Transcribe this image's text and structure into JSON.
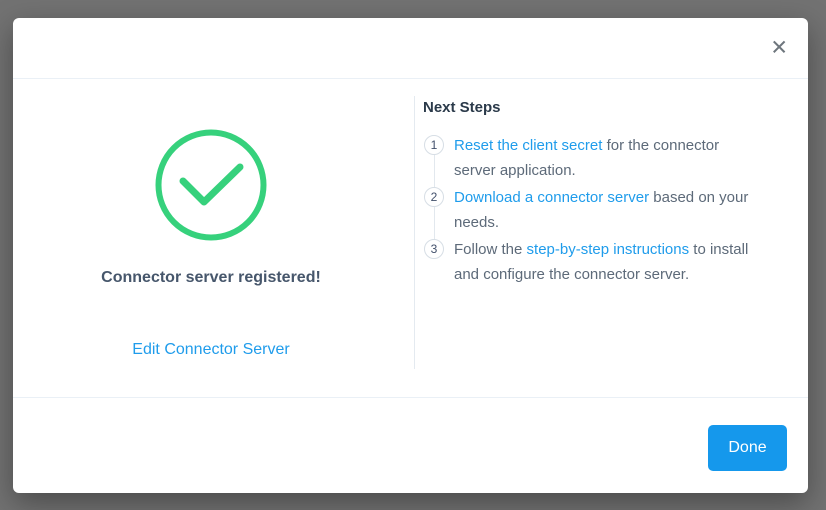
{
  "modal": {
    "close_glyph": "✕",
    "success": {
      "title": "Connector server registered!",
      "edit_link_label": "Edit Connector Server",
      "check_icon": "checkmark-in-circle"
    },
    "next_steps": {
      "heading": "Next Steps",
      "steps": [
        {
          "number": "1",
          "segments": [
            {
              "text": "Reset the client secret",
              "link": true
            },
            {
              "text": " for the connector",
              "link": false
            },
            {
              "break": true
            },
            {
              "text": "server application.",
              "link": false
            }
          ]
        },
        {
          "number": "2",
          "segments": [
            {
              "text": "Download a connector server",
              "link": true
            },
            {
              "text": " based on your",
              "link": false
            },
            {
              "break": true
            },
            {
              "text": "needs.",
              "link": false
            }
          ]
        },
        {
          "number": "3",
          "segments": [
            {
              "text": "Follow the ",
              "link": false
            },
            {
              "text": "step-by-step instructions",
              "link": true
            },
            {
              "text": " to install",
              "link": false
            },
            {
              "break": true
            },
            {
              "text": "and configure the connector server.",
              "link": false
            }
          ]
        }
      ]
    },
    "footer": {
      "done_label": "Done"
    }
  },
  "colors": {
    "link_blue": "#1f9ceb",
    "button_blue": "#1598ec",
    "success_green": "#36d17c"
  }
}
